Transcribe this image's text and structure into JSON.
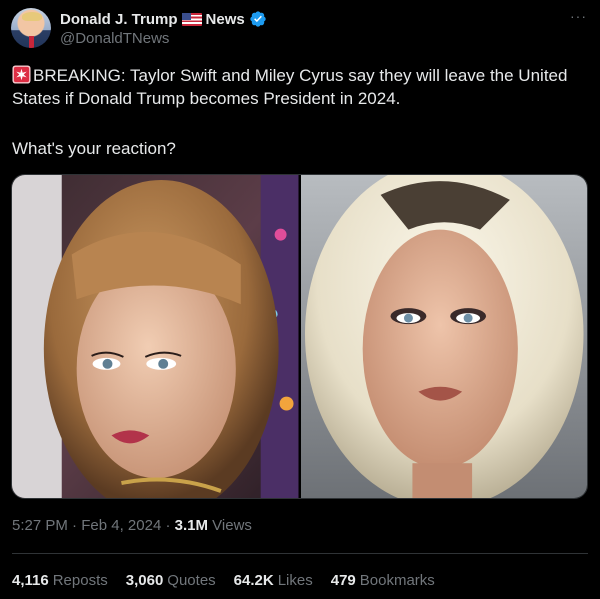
{
  "author": {
    "display_name": "Donald J. Trump",
    "name_suffix": "News",
    "handle": "@DonaldTNews",
    "avatar_icon": "portrait-avatar",
    "badge_icon": "verified-badge-icon",
    "flag_icon": "us-flag-icon"
  },
  "tweet": {
    "emoji_icon": "siren-icon",
    "text_line": "BREAKING: Taylor Swift and Miley Cyrus say they will leave the United States if Donald Trump becomes President in 2024.",
    "text_question": "What's your reaction?"
  },
  "media": {
    "photos": [
      "photo-left",
      "photo-right"
    ]
  },
  "meta": {
    "time": "5:27 PM",
    "separator": "·",
    "date": "Feb 4, 2024",
    "views_count": "3.1M",
    "views_label": "Views"
  },
  "stats": {
    "reposts_count": "4,116",
    "reposts_label": "Reposts",
    "quotes_count": "3,060",
    "quotes_label": "Quotes",
    "likes_count": "64.2K",
    "likes_label": "Likes",
    "bookmarks_count": "479",
    "bookmarks_label": "Bookmarks"
  },
  "colors": {
    "background": "#000000",
    "primary_text": "#e7e9ea",
    "secondary_text": "#71767b",
    "verified": "#1d9bf0",
    "divider": "#2f3336"
  }
}
